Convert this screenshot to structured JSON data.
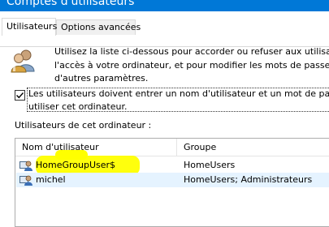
{
  "window": {
    "title": "Comptes d'utilisateurs"
  },
  "tabs": [
    {
      "label": "Utilisateurs",
      "active": true
    },
    {
      "label": "Options avancées",
      "active": false
    }
  ],
  "intro": {
    "line1": "Utilisez la liste ci-dessous pour accorder ou refuser aux utilisat",
    "line2": "l'accès à votre ordinateur, et pour modifier les mots de passe et",
    "line3": "d'autres paramètres."
  },
  "require_password": {
    "checked": true,
    "line1": "Les utilisateurs doivent entrer un nom d'utilisateur et un mot de passe",
    "line2": "utiliser cet ordinateur."
  },
  "users_section": {
    "label": "Utilisateurs de cet ordinateur :"
  },
  "users_table": {
    "columns": [
      "Nom d'utilisateur",
      "Groupe"
    ],
    "rows": [
      {
        "name": "HomeGroupUser$",
        "group": "HomeUsers",
        "highlighted": true
      },
      {
        "name": "michel",
        "group": "HomeUsers; Administrateurs",
        "highlighted": false
      }
    ]
  },
  "colors": {
    "titlebar": "#0078d7",
    "selection": "#e5f3ff",
    "highlighter": "#ffff00"
  }
}
